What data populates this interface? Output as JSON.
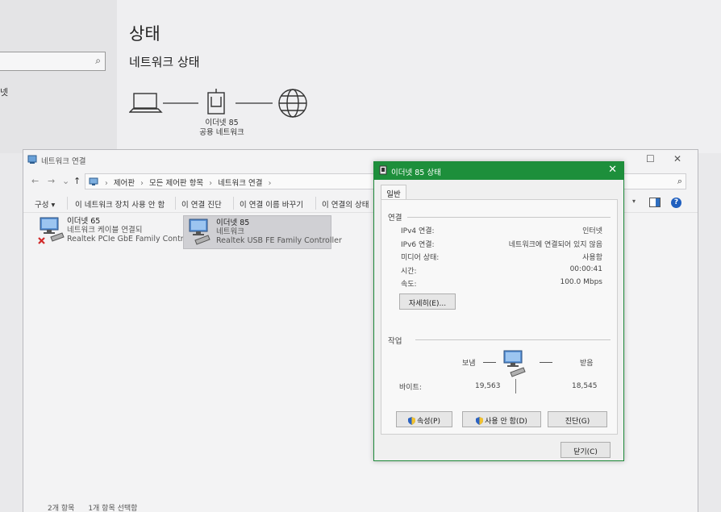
{
  "settings": {
    "title": "상태",
    "subtitle": "네트워크 상태",
    "left_fragment": "넷",
    "network_name": "이더넷 85",
    "network_type": "공용 네트워크",
    "search_icon": "search-icon"
  },
  "network_window": {
    "title": "네트워크 연결",
    "breadcrumbs": [
      "제어판",
      "모든 제어판 항목",
      "네트워크 연결"
    ],
    "toolbar": {
      "organize": "구성 ▾",
      "disable": "이 네트워크 장치 사용 안 함",
      "diagnose": "이 연결 진단",
      "rename": "이 연결 이름 바꾸기",
      "status": "이 연결의 상태"
    },
    "connections": [
      {
        "name": "이더넷 65",
        "status": "네트워크 케이블 연결되",
        "adapter": "Realtek PCIe GbE Family Controll..."
      },
      {
        "name": "이더넷 85",
        "status": "네트워크",
        "adapter": "Realtek USB FE Family Controller"
      }
    ],
    "status_bar": {
      "count": "2개 항목",
      "selected": "1개 항목 선택함"
    }
  },
  "status_dialog": {
    "title": "이더넷 85 상태",
    "tab": "일반",
    "connection_group": "연결",
    "fields": [
      {
        "key": "IPv4 연결:",
        "value": "인터넷"
      },
      {
        "key": "IPv6 연결:",
        "value": "네트워크에 연결되어 있지 않음"
      },
      {
        "key": "미디어 상태:",
        "value": "사용함"
      },
      {
        "key": "시간:",
        "value": "00:00:41"
      },
      {
        "key": "속도:",
        "value": "100.0 Mbps"
      }
    ],
    "details_button": "자세히(E)...",
    "activity_group": "작업",
    "sent_label": "보냄",
    "received_label": "받음",
    "bytes_label": "바이트:",
    "bytes_sent": "19,563",
    "bytes_received": "18,545",
    "buttons": {
      "properties": "속성(P)",
      "disable": "사용 안 함(D)",
      "diagnose": "진단(G)",
      "close": "닫기(C)"
    }
  },
  "colors": {
    "dialog_title": "#1d8f3b",
    "help": "#1f5fbf"
  }
}
